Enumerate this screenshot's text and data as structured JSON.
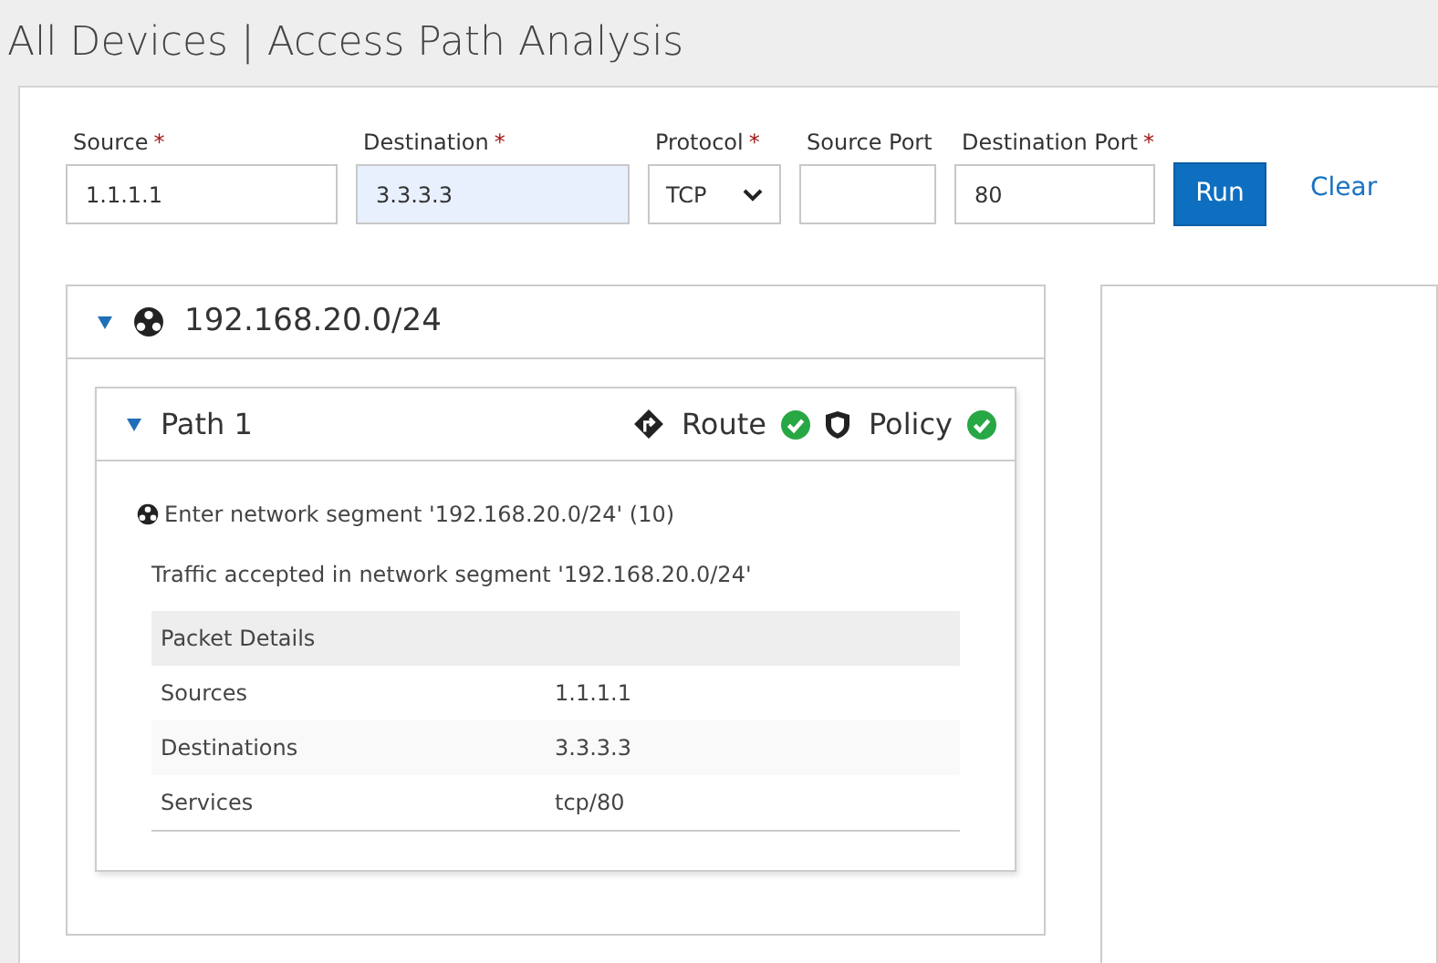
{
  "page_title": "All Devices | Access Path Analysis",
  "form": {
    "fields": [
      {
        "kind": "input",
        "label": "Source",
        "required_mark": "*",
        "value": "1.1.1.1",
        "focused": false
      },
      {
        "kind": "input",
        "label": "Destination",
        "required_mark": "*",
        "value": "3.3.3.3",
        "focused": true
      },
      {
        "kind": "select",
        "label": "Protocol",
        "required_mark": "*",
        "value": "TCP",
        "focused": false
      },
      {
        "kind": "input",
        "label": "Source Port",
        "focused": false
      },
      {
        "kind": "input",
        "label": "Destination Port",
        "required_mark": "*",
        "value": "80",
        "focused": false
      }
    ],
    "run_button": "Run",
    "clear_link": "Clear"
  },
  "segment": {
    "title": "192.168.20.0/24",
    "expanded": true,
    "path": {
      "title": "Path 1",
      "expanded": true,
      "checks": [
        {
          "kind": "route",
          "label": "Route",
          "passed": true
        },
        {
          "kind": "policy",
          "label": "Policy",
          "passed": true
        }
      ],
      "step": "Enter network segment '192.168.20.0/24' (10)",
      "message": "Traffic accepted in network segment '192.168.20.0/24'",
      "table": {
        "heading": "Packet Details",
        "rows": [
          {
            "label": "Sources",
            "value": "1.1.1.1"
          },
          {
            "label": "Destinations",
            "value": "3.3.3.3"
          },
          {
            "label": "Services",
            "value": "tcp/80"
          }
        ]
      }
    }
  }
}
